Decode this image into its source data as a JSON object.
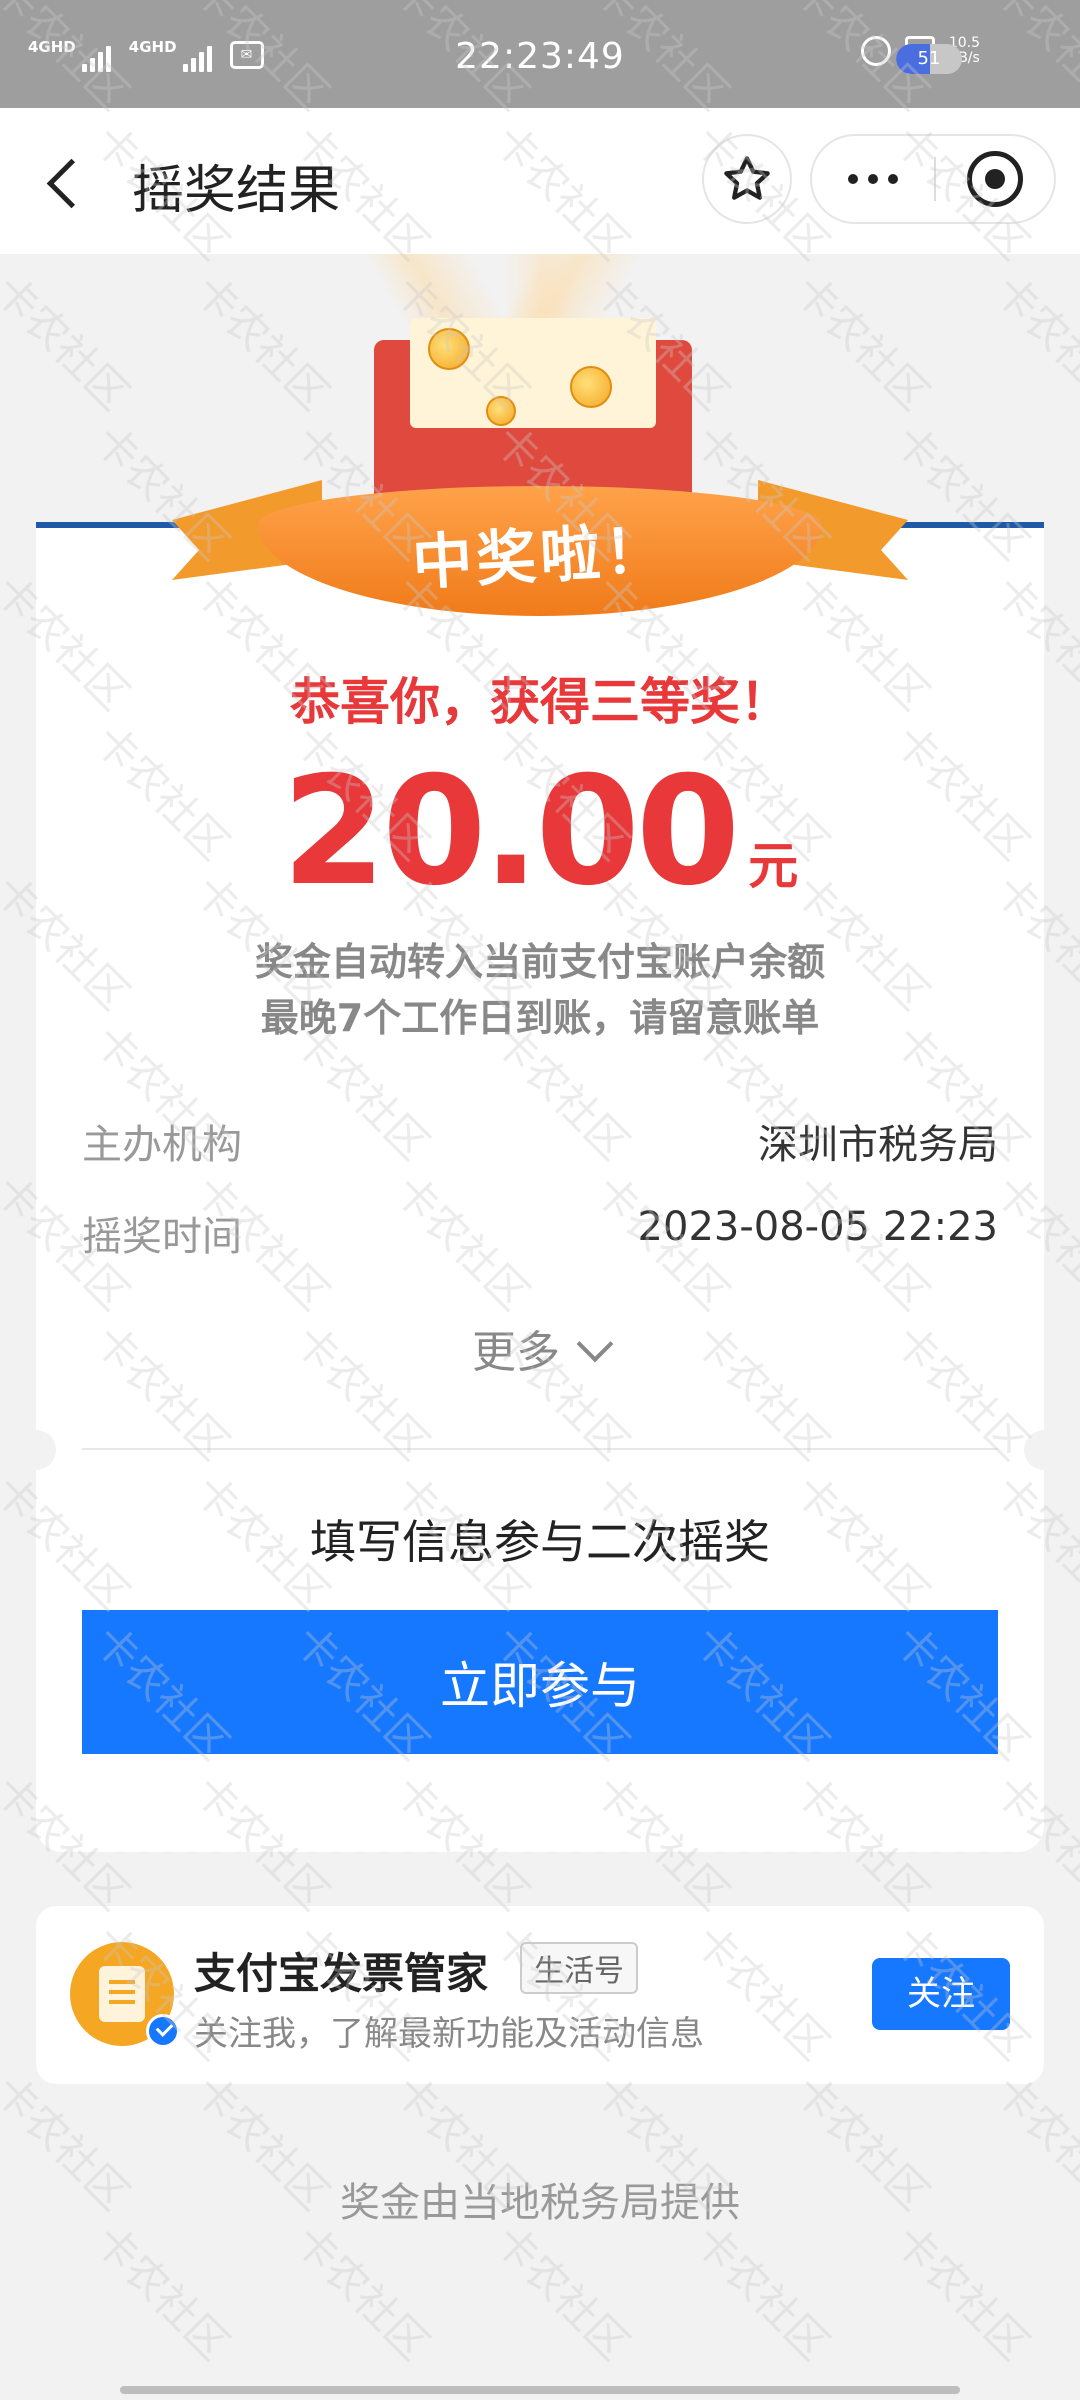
{
  "status_bar": {
    "sig1_label": "4GHD",
    "sig2_label": "4GHD",
    "time": "22:23:49",
    "speed_value": "10.5",
    "speed_unit": "KB/s",
    "battery": "51",
    "battery_level": 0.51
  },
  "nav": {
    "title": "摇奖结果",
    "icons": [
      "back-arrow-icon",
      "star-icon",
      "more-dots-icon",
      "close-circle-icon"
    ]
  },
  "banner": {
    "ribbon_text": "中奖啦！"
  },
  "result": {
    "congrats": "恭喜你，获得三等奖！",
    "amount": "20.00",
    "unit": "元",
    "notice_line1": "奖金自动转入当前支付宝账户余额",
    "notice_line2": "最晚7个工作日到账，请留意账单"
  },
  "details": [
    {
      "key": "主办机构",
      "value": "深圳市税务局"
    },
    {
      "key": "摇奖时间",
      "value": "2023-08-05 22:23"
    }
  ],
  "more_label": "更多",
  "second_draw": {
    "title": "填写信息参与二次摇奖",
    "button": "立即参与"
  },
  "life_account": {
    "name": "支付宝发票管家",
    "tag": "生活号",
    "desc": "关注我，了解最新功能及活动信息",
    "follow": "关注"
  },
  "footer": "奖金由当地税务局提供",
  "watermark_text": "卡农社区",
  "colors": {
    "accent_blue": "#1677ff",
    "prize_red": "#e8383a",
    "ribbon_orange": "#f39a2c"
  }
}
